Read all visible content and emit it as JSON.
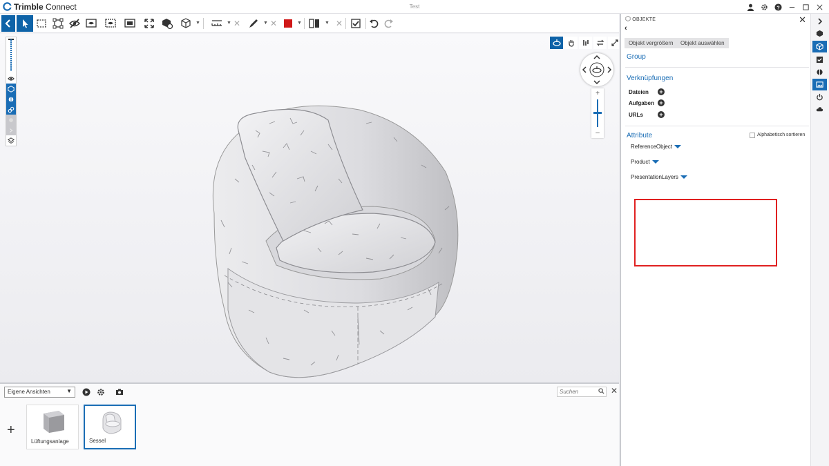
{
  "app": {
    "name_bold": "Trimble",
    "name_rest": " Connect",
    "document_title": "Test"
  },
  "window_controls": [
    "user-icon",
    "gear-icon",
    "help-icon",
    "minimize-icon",
    "maximize-icon",
    "close-icon"
  ],
  "colors": {
    "accent": "#1a6db5",
    "toolbar_active": "#0e63a8",
    "highlight_box": "#e02020",
    "color_tool": "#d01818"
  },
  "bottom_panel": {
    "views_select": "Eigene Ansichten",
    "search_placeholder": "Suchen",
    "views": [
      {
        "label": "Lüftungsanlage",
        "selected": false
      },
      {
        "label": "Sessel",
        "selected": true
      }
    ]
  },
  "right_panel": {
    "header": "OBJEKTE",
    "buttons": {
      "zoom_object": "Objekt vergrößern",
      "select_object": "Objekt auswählen"
    },
    "group_label": "Group",
    "links_section": {
      "title": "Verknüpfungen",
      "items": [
        "Dateien",
        "Aufgaben",
        "URLs"
      ]
    },
    "attributes_section": {
      "title": "Attribute",
      "sort_label": "Alphabetisch sortieren",
      "sort_checked": false,
      "items": [
        "ReferenceObject",
        "Product",
        "PresentationLayers"
      ]
    }
  },
  "right_rail": [
    "chevron-right-icon",
    "cube-icon",
    "object-icon",
    "checklist-icon",
    "clash-icon",
    "image-icon",
    "power-icon",
    "cloud-icon"
  ]
}
